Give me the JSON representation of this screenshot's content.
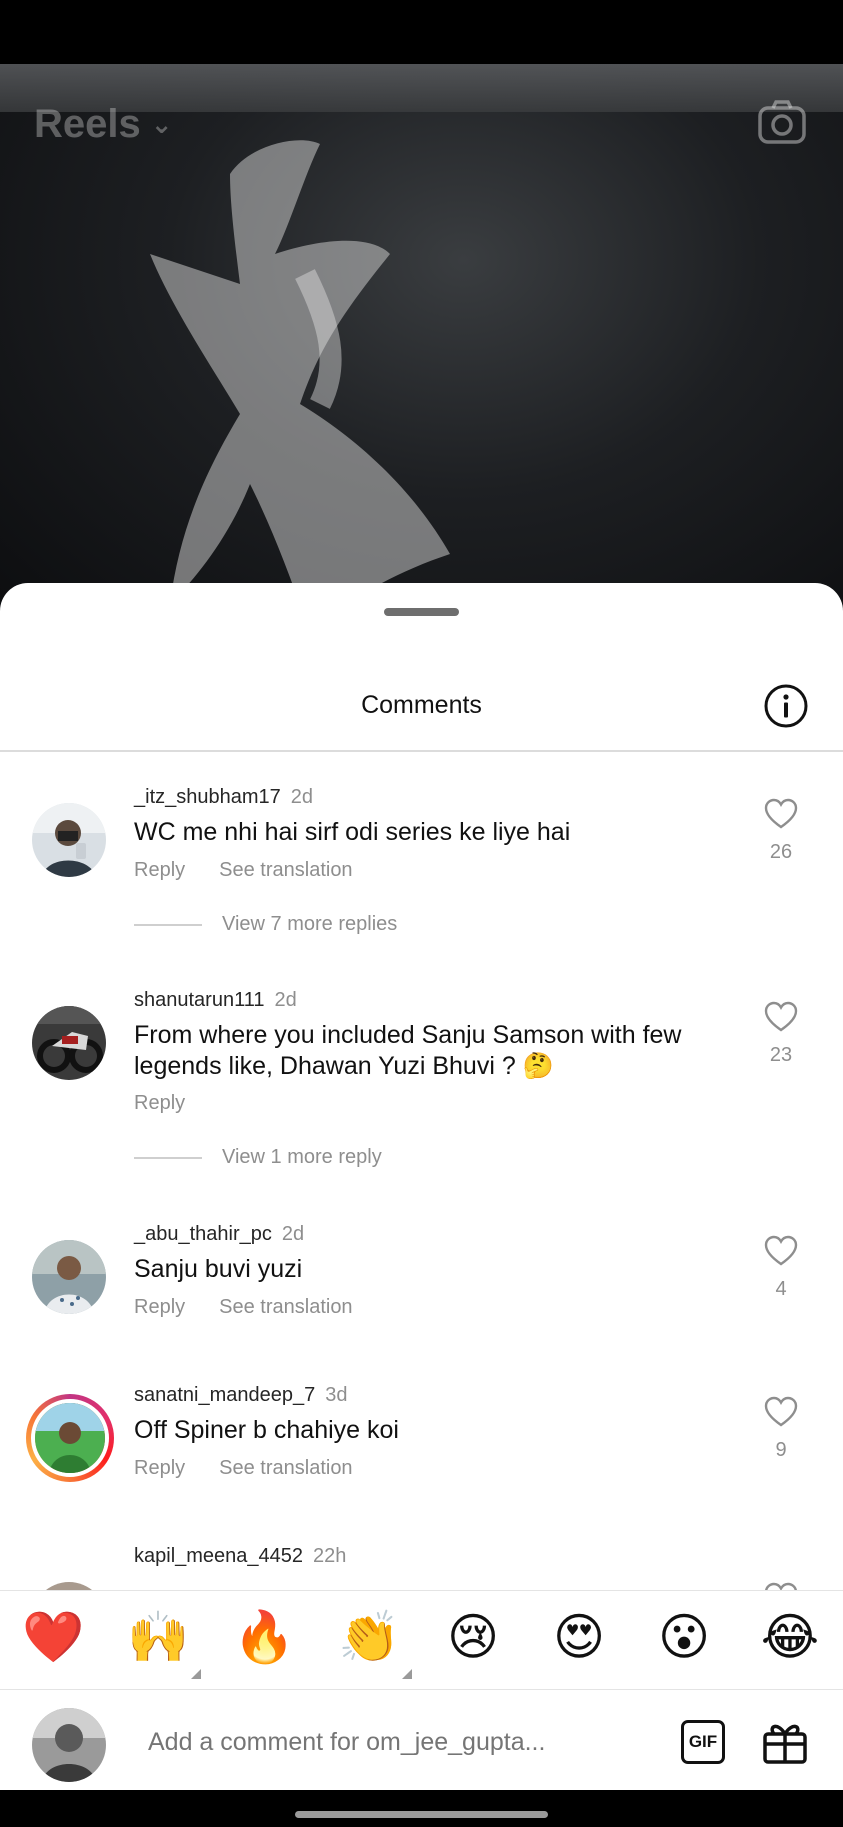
{
  "header": {
    "title": "Reels"
  },
  "sheet": {
    "title": "Comments"
  },
  "comments": [
    {
      "username": "_itz_shubham17",
      "time": "2d",
      "text": "WC me nhi hai sirf odi series ke liye hai",
      "reply": "Reply",
      "translate": "See translation",
      "likes": "26",
      "view_replies": "View 7 more replies"
    },
    {
      "username": "shanutarun111",
      "time": "2d",
      "text": "From where you included Sanju Samson with few legends like, Dhawan Yuzi Bhuvi ? 🤔",
      "reply": "Reply",
      "likes": "23",
      "view_replies": "View 1 more reply"
    },
    {
      "username": "_abu_thahir_pc",
      "time": "2d",
      "text": "Sanju buvi yuzi",
      "reply": "Reply",
      "translate": "See translation",
      "likes": "4"
    },
    {
      "username": "sanatni_mandeep_7",
      "time": "3d",
      "text": "Off Spiner b chahiye koi",
      "reply": "Reply",
      "translate": "See translation",
      "likes": "9"
    },
    {
      "username": "kapil_meena_4452",
      "time": "22h"
    }
  ],
  "emoji_bar": [
    "❤️",
    "🙌",
    "🔥",
    "👏",
    "😢",
    "😍",
    "😮",
    "😂"
  ],
  "compose": {
    "placeholder": "Add a comment for om_jee_gupta...",
    "gif_label": "GIF"
  },
  "icons": {
    "camera": "camera-icon",
    "info": "info-icon",
    "heart": "heart-outline-icon",
    "gift": "gift-icon"
  }
}
